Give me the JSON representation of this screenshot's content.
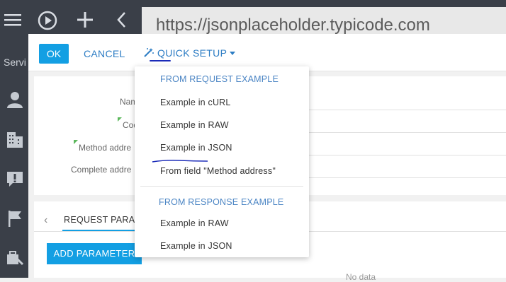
{
  "browser": {
    "url": "https://jsonplaceholder.typicode.com"
  },
  "sidebar": {
    "partial_label": "Servi"
  },
  "toolbar": {
    "ok_label": "OK",
    "cancel_label": "CANCEL",
    "quick_setup_label": "QUICK SETUP"
  },
  "form": {
    "name_label": "Nam",
    "code_label": "Cod",
    "method_address_label": "Method addre",
    "complete_address_label": "Complete addre"
  },
  "params": {
    "tab_label": "REQUEST PARAM",
    "add_button_label": "ADD PARAMETER",
    "no_data_label": "No data"
  },
  "quick_setup_menu": {
    "request_header": "FROM REQUEST EXAMPLE",
    "request_items": [
      "Example in cURL",
      "Example in RAW",
      "Example in JSON",
      "From field \"Method address\""
    ],
    "response_header": "FROM RESPONSE EXAMPLE",
    "response_items": [
      "Example in RAW",
      "Example in JSON"
    ]
  },
  "colors": {
    "accent": "#139fe3",
    "link": "#2d7dc4",
    "sidebar_bg": "#3a3f48",
    "required_marker": "#5cb85c",
    "annotation": "#1a2ab8"
  }
}
